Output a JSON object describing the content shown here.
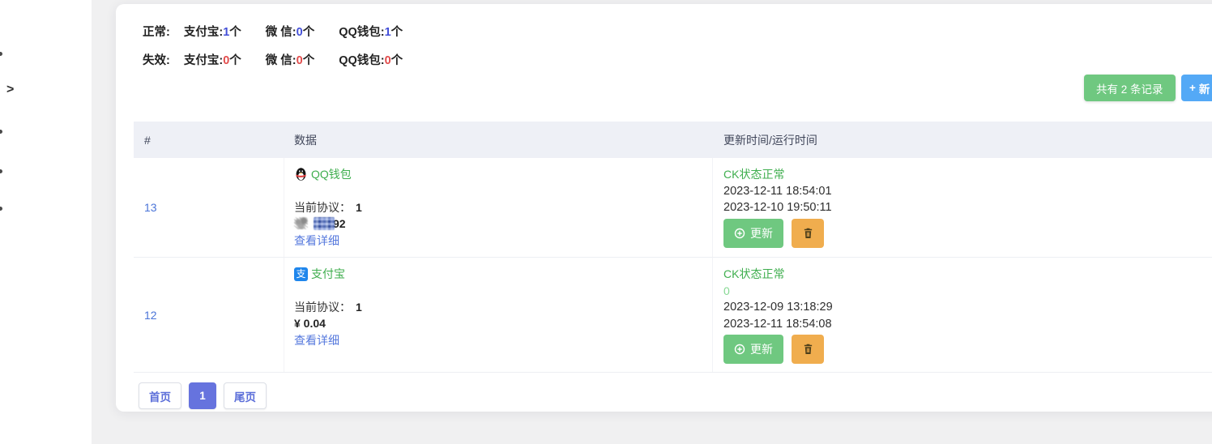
{
  "icons": {
    "chevron": ">",
    "plus": "+",
    "alipay_char": "支"
  },
  "stats": {
    "rows": [
      {
        "label": "正常:",
        "items": [
          {
            "name": "支付宝:",
            "count": "1",
            "suffix": "个"
          },
          {
            "name": "微 信:",
            "count": "0",
            "suffix": "个"
          },
          {
            "name": "QQ钱包:",
            "count": "1",
            "suffix": "个"
          }
        ]
      },
      {
        "label": "失效:",
        "items": [
          {
            "name": "支付宝:",
            "count": "0",
            "suffix": "个"
          },
          {
            "name": "微 信:",
            "count": "0",
            "suffix": "个"
          },
          {
            "name": "QQ钱包:",
            "count": "0",
            "suffix": "个"
          }
        ]
      }
    ]
  },
  "toolbar": {
    "record_count": "共有 2 条记录",
    "add_label": "新"
  },
  "table": {
    "headers": [
      "#",
      "数据",
      "更新时间/运行时间"
    ],
    "rows": [
      {
        "id": "13",
        "wallet_name": "QQ钱包",
        "wallet_type": "qq",
        "protocol_label": "当前协议：",
        "protocol_value": "1",
        "amount_visible": "92",
        "amount_censored": true,
        "detail_link": "查看详细",
        "status": "CK状态正常",
        "update_time": "2023-12-11 18:54:01",
        "run_time": "2023-12-10 19:50:11"
      },
      {
        "id": "12",
        "wallet_name": "支付宝",
        "wallet_type": "alipay",
        "protocol_label": "当前协议：",
        "protocol_value": "1",
        "amount": "¥ 0.04",
        "amount_censored": false,
        "detail_link": "查看详细",
        "status": "CK状态正常",
        "status_extra": "0",
        "update_time": "2023-12-09 13:18:29",
        "run_time": "2023-12-11 18:54:08"
      }
    ]
  },
  "actions": {
    "update": "更新"
  },
  "pagination": {
    "first": "首页",
    "current": "1",
    "last": "尾页"
  },
  "colors": {
    "success_green": "#6fc880",
    "warning_orange": "#f0ad4e",
    "info_blue": "#54a9f6",
    "link_blue": "#4a74d8",
    "status_green": "#3fae4e",
    "status_light_green": "#86d893",
    "active_page": "#6673de",
    "normal_count": "#4450d8",
    "invalid_count": "#e24c4c",
    "header_bg": "#eef0f6"
  }
}
